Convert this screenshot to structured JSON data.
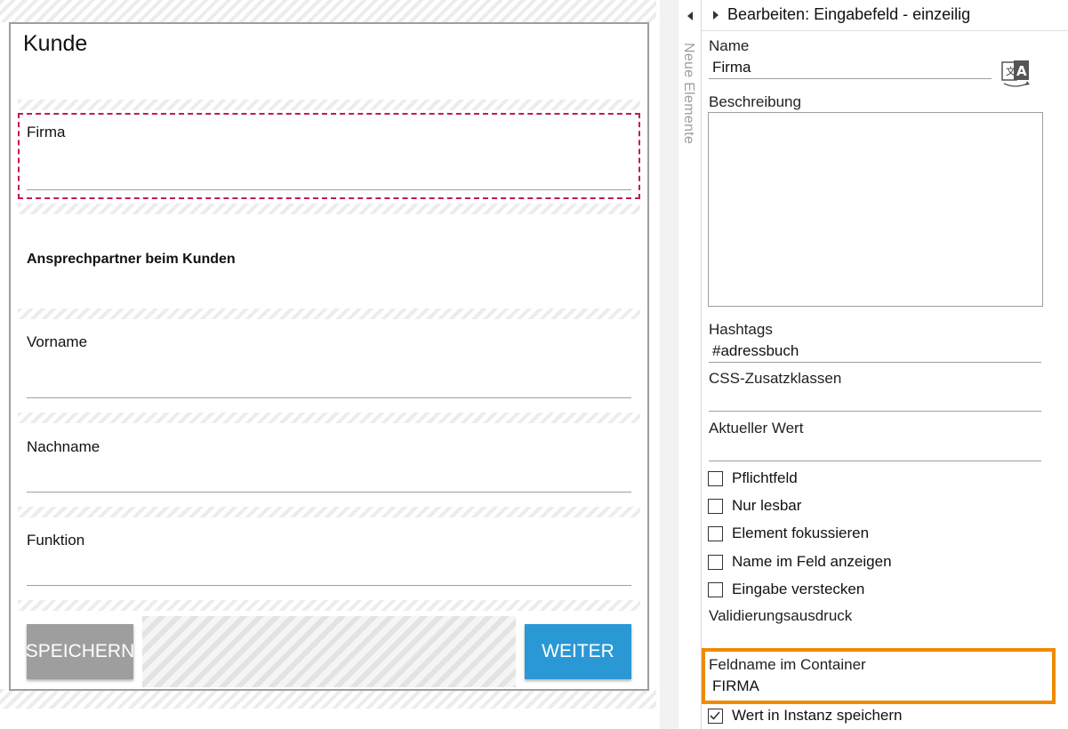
{
  "form": {
    "title": "Kunde",
    "fields": {
      "firma": "Firma",
      "vorname": "Vorname",
      "nachname": "Nachname",
      "funktion": "Funktion"
    },
    "subheading": "Ansprechpartner beim Kunden",
    "save_label": "SPEICHERN",
    "next_label": "WEITER"
  },
  "sidetab": {
    "label": "Neue Elemente"
  },
  "panel": {
    "title": "Bearbeiten: Eingabefeld - einzeilig",
    "name_label": "Name",
    "name_value": "Firma",
    "description_label": "Beschreibung",
    "description_value": "",
    "hashtags_label": "Hashtags",
    "hashtags_value": "#adressbuch",
    "css_label": "CSS-Zusatzklassen",
    "css_value": "",
    "current_value_label": "Aktueller Wert",
    "current_value": "",
    "checkboxes": [
      {
        "label": "Pflichtfeld",
        "checked": false
      },
      {
        "label": "Nur lesbar",
        "checked": false
      },
      {
        "label": "Element fokussieren",
        "checked": false
      },
      {
        "label": "Name im Feld anzeigen",
        "checked": false
      },
      {
        "label": "Eingabe verstecken",
        "checked": false
      }
    ],
    "validation_label": "Validierungsausdruck",
    "container_field_label": "Feldname im Container",
    "container_field_value": "FIRMA",
    "save_in_instance_label": "Wert in Instanz speichern",
    "save_in_instance_checked": true
  },
  "colors": {
    "accent_blue": "#2a98d4",
    "selection": "#c2185b",
    "highlight": "#f08a00",
    "button_gray": "#9e9e9e"
  },
  "icons": {
    "translate": "translate-icon",
    "collapse": "chevron-left-icon",
    "expand": "chevron-right-icon",
    "check": "check-icon"
  }
}
